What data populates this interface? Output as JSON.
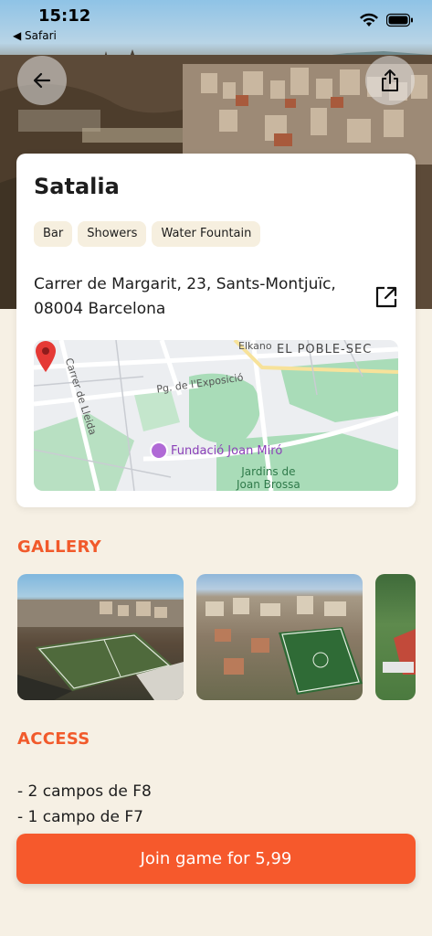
{
  "status_bar": {
    "time": "15:12",
    "back_app": "◀ Safari"
  },
  "header": {
    "back_icon": "arrow-left-icon",
    "share_icon": "share-icon"
  },
  "venue": {
    "name": "Satalia",
    "tags": [
      "Bar",
      "Showers",
      "Water Fountain"
    ],
    "address_line1": "Carrer de Margarit, 23, Sants-Montjuïc,",
    "address_line2": "08004 Barcelona",
    "open_link_icon": "external-link-icon"
  },
  "map": {
    "labels": {
      "poble_sec": "EL POBLE-SEC",
      "elkano": "Elkano",
      "lleida": "Carrer de Lleida",
      "expo": "Pg. de l'Exposició",
      "miro": "Fundació Joan Miró",
      "jardins_1": "Jardins de",
      "jardins_2": "Joan Brossa"
    },
    "pin_color": "#e53935"
  },
  "gallery": {
    "title": "GALLERY"
  },
  "access": {
    "title": "ACCESS",
    "lines": [
      "- 2 campos de F8",
      "- 1 campo de F7"
    ]
  },
  "cta": {
    "label": "Join game for 5,99"
  },
  "colors": {
    "accent": "#f6592c",
    "section_title": "#f15a2b",
    "background": "#f6f0e4",
    "tag_bg": "#f6efdf"
  }
}
